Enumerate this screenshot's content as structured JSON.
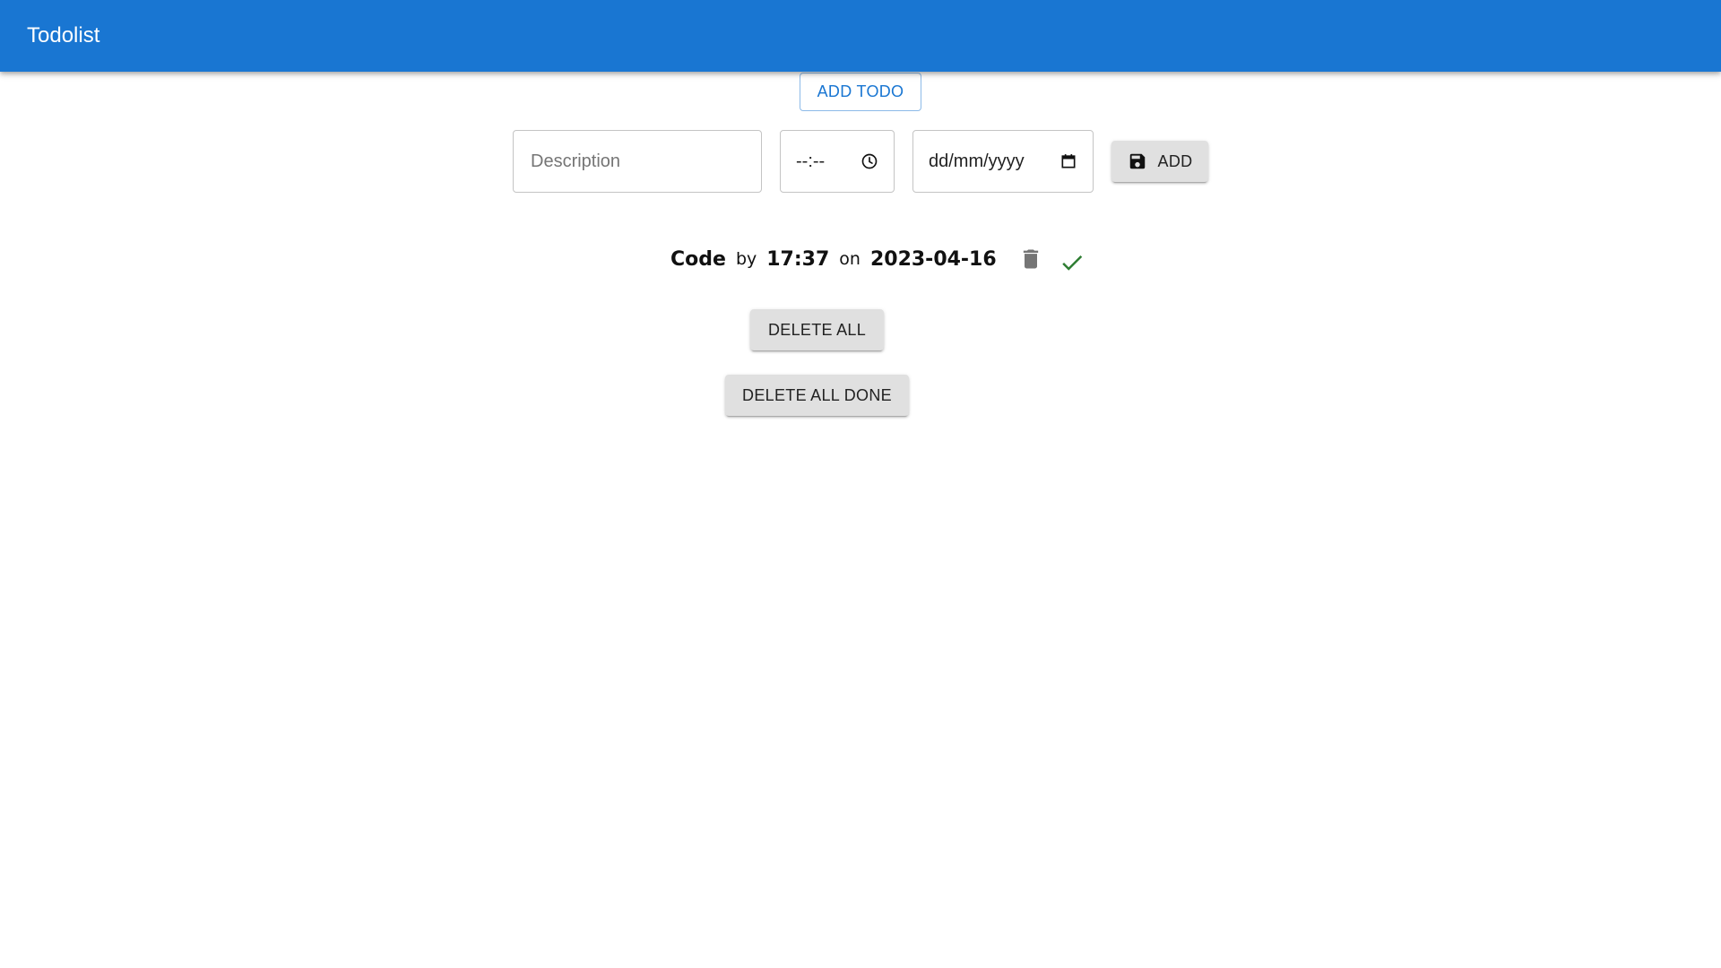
{
  "appbar": {
    "title": "Todolist"
  },
  "toolbar": {
    "add_todo_label": "ADD TODO"
  },
  "form": {
    "description_placeholder": "Description",
    "time_value": "--:--",
    "date_value": "dd/mm/yyyy",
    "add_label": "ADD"
  },
  "todos": [
    {
      "description": "Code",
      "by_label": "by",
      "time": "17:37",
      "on_label": "on",
      "date": "2023-04-16"
    }
  ],
  "actions": {
    "delete_all_label": "DELETE ALL",
    "delete_all_done_label": "DELETE ALL DONE"
  },
  "icons": {
    "clock": "clock-icon",
    "calendar": "calendar-icon",
    "save": "save-icon",
    "trash": "trash-icon",
    "check": "check-icon"
  },
  "colors": {
    "primary": "#1976d2",
    "check": "#2e7d32",
    "trash": "#757575",
    "button_bg": "#e0e0e0"
  }
}
